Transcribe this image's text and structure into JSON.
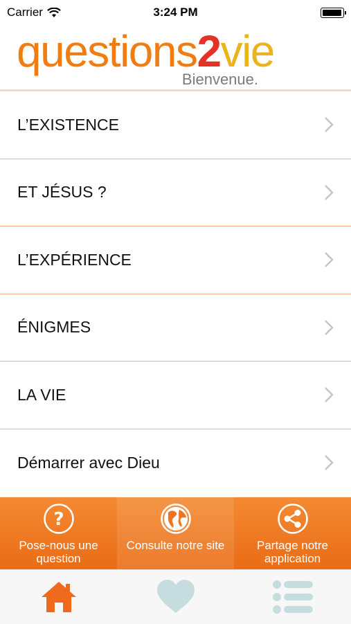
{
  "status_bar": {
    "carrier": "Carrier",
    "time": "3:24 PM",
    "battery_level": 1.0
  },
  "header": {
    "logo_part1": "questions",
    "logo_part2": "2",
    "logo_part3": "vie",
    "tagline": "Bienvenue."
  },
  "menu": {
    "items": [
      {
        "label": "L’EXISTENCE"
      },
      {
        "label": "ET JÉSUS ?"
      },
      {
        "label": "L’EXPÉRIENCE"
      },
      {
        "label": "ÉNIGMES"
      },
      {
        "label": "LA VIE"
      },
      {
        "label": "Démarrer avec Dieu"
      }
    ]
  },
  "actions": {
    "items": [
      {
        "label": "Pose-nous une question",
        "icon": "question-icon"
      },
      {
        "label": "Consulte notre site",
        "icon": "globe-icon"
      },
      {
        "label": "Partage notre application",
        "icon": "share-icon"
      }
    ]
  },
  "tabbar": {
    "items": [
      {
        "icon": "home-icon",
        "selected": true
      },
      {
        "icon": "heart-icon",
        "selected": false
      },
      {
        "icon": "list-icon",
        "selected": false
      }
    ]
  },
  "colors": {
    "accent_orange": "#f07d12",
    "logo_red": "#e43326",
    "logo_yellow": "#e9b41c",
    "tab_inactive": "#c6dde0",
    "tab_active": "#f06a1e",
    "divider": "#f3b08a"
  }
}
